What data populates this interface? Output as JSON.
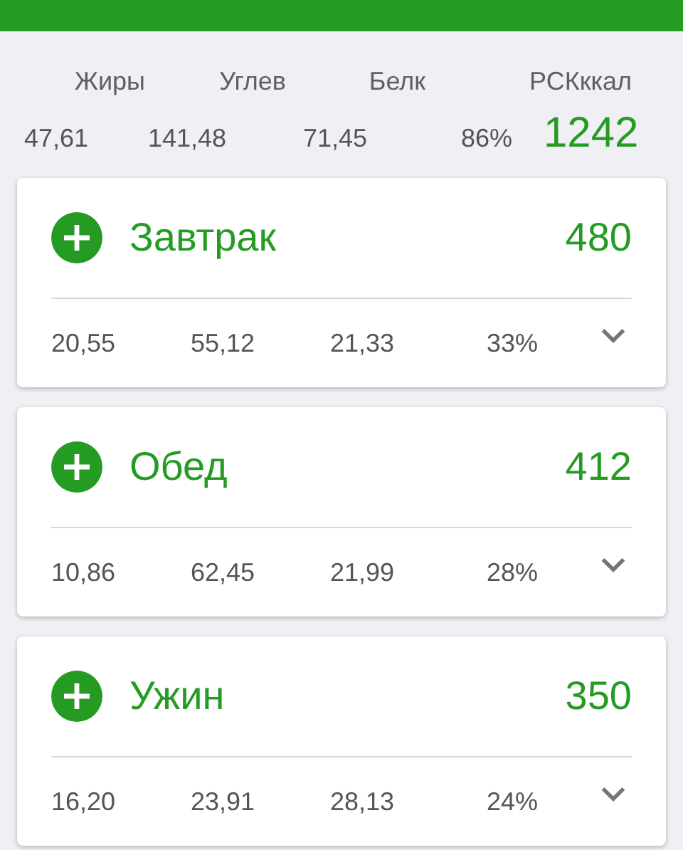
{
  "summary": {
    "labels": [
      "Жиры",
      "Углев",
      "Белк",
      "РСКккал"
    ],
    "values": [
      "47,61",
      "141,48",
      "71,45",
      "86%"
    ],
    "total": "1242"
  },
  "meals": [
    {
      "title": "Завтрак",
      "calories": "480",
      "values": [
        "20,55",
        "55,12",
        "21,33",
        "33%"
      ],
      "expanded": false
    },
    {
      "title": "Обед",
      "calories": "412",
      "values": [
        "10,86",
        "62,45",
        "21,99",
        "28%"
      ],
      "expanded": false
    },
    {
      "title": "Ужин",
      "calories": "350",
      "values": [
        "16,20",
        "23,91",
        "28,13",
        "24%"
      ],
      "expanded": false
    }
  ]
}
